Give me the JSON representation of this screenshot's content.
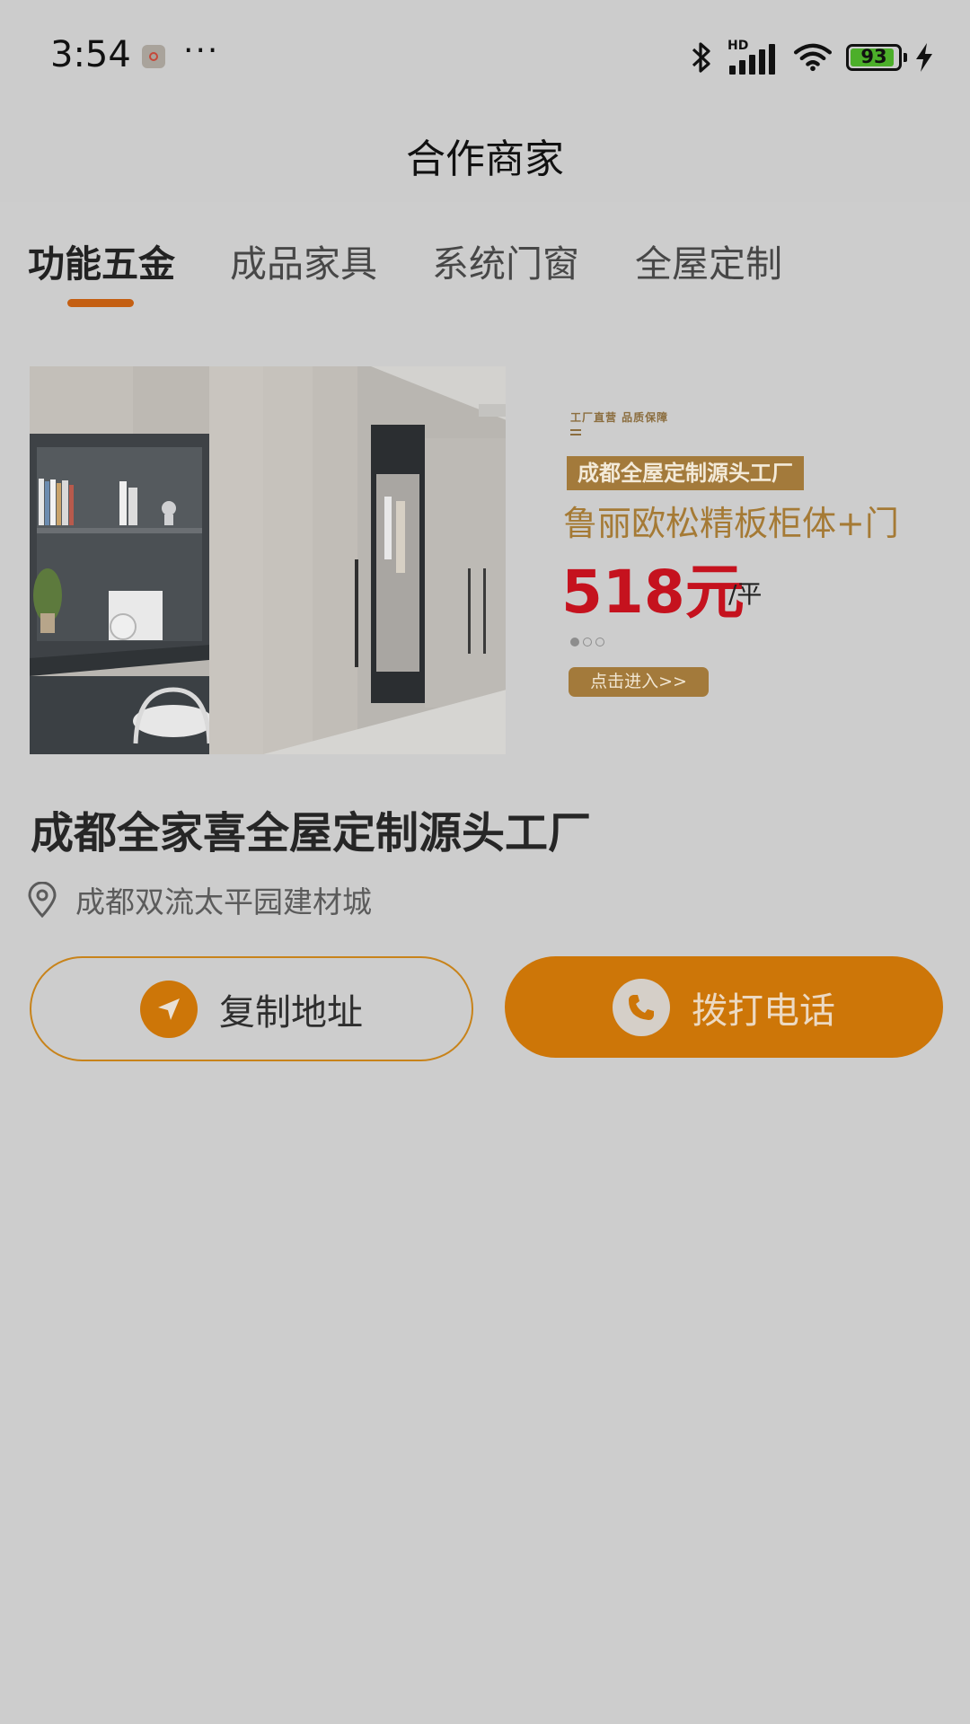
{
  "status_bar": {
    "time": "3:54",
    "more": "···",
    "signal_label": "HD",
    "battery": "93",
    "battery_level": 0.93,
    "icons": [
      "record-icon",
      "bluetooth-icon",
      "signal-icon",
      "wifi-icon",
      "battery-icon",
      "charging-icon"
    ]
  },
  "header": {
    "title": "合作商家"
  },
  "tabs": [
    {
      "label": "功能五金",
      "active": true
    },
    {
      "label": "成品家具",
      "active": false
    },
    {
      "label": "系统门窗",
      "active": false
    },
    {
      "label": "全屋定制",
      "active": false
    }
  ],
  "banner": {
    "slogan": "工厂直营 品质保障",
    "tag": "成都全屋定制源头工厂",
    "product": "鲁丽欧松精板柜体+门",
    "price": "518元",
    "unit": "/平",
    "enter": "点击进入>>"
  },
  "merchant": {
    "name": "成都全家喜全屋定制源头工厂",
    "address": "成都双流太平园建材城"
  },
  "actions": {
    "copy_address": "复制地址",
    "call": "拨打电话"
  },
  "colors": {
    "accent": "#cd7608",
    "tab_underline": "#c45f12",
    "price": "#c5121e",
    "banner_gold": "#a37a3b"
  }
}
